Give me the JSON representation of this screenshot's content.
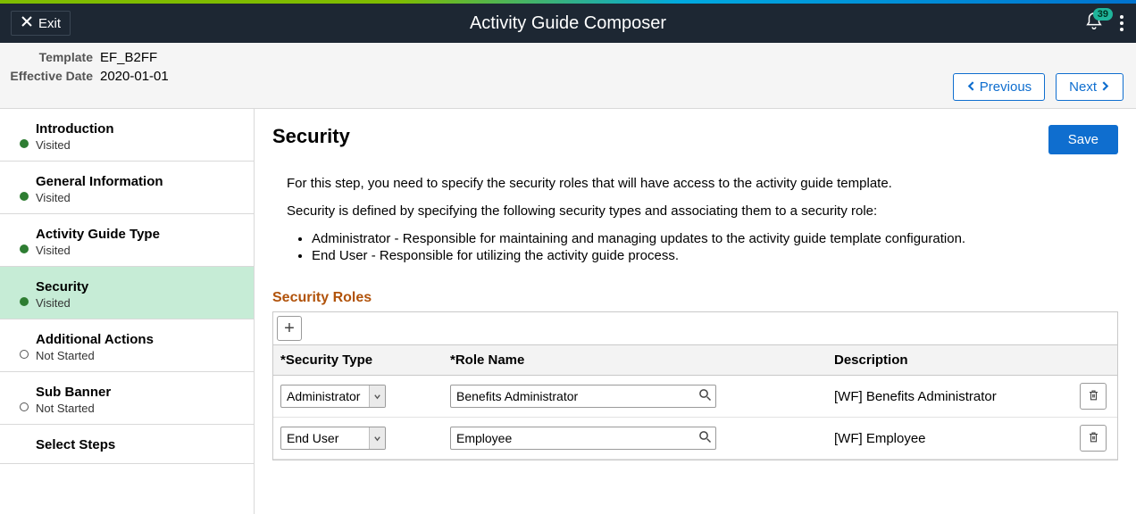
{
  "header": {
    "exit_label": "Exit",
    "title": "Activity Guide Composer",
    "notification_count": "39"
  },
  "meta": {
    "template_label": "Template",
    "template_value": "EF_B2FF",
    "effective_date_label": "Effective Date",
    "effective_date_value": "2020-01-01"
  },
  "nav": {
    "previous_label": "Previous",
    "next_label": "Next"
  },
  "sidebar": {
    "items": [
      {
        "title": "Introduction",
        "status": "Visited",
        "dot": "visited"
      },
      {
        "title": "General Information",
        "status": "Visited",
        "dot": "visited"
      },
      {
        "title": "Activity Guide Type",
        "status": "Visited",
        "dot": "visited"
      },
      {
        "title": "Security",
        "status": "Visited",
        "dot": "visited",
        "active": true
      },
      {
        "title": "Additional Actions",
        "status": "Not Started",
        "dot": "notstarted"
      },
      {
        "title": "Sub Banner",
        "status": "Not Started",
        "dot": "notstarted"
      },
      {
        "title": "Select Steps",
        "status": "",
        "dot": ""
      }
    ]
  },
  "main": {
    "title": "Security",
    "save_label": "Save",
    "intro_p1": "For this step, you need to specify the security roles that will have access to the activity guide template.",
    "intro_p2": "Security is defined by specifying the following security types and associating them to a security role:",
    "bullet1": "Administrator - Responsible for maintaining and managing updates to the activity guide template configuration.",
    "bullet2": "End User - Responsible for utilizing the activity guide process.",
    "section_title": "Security Roles",
    "col_type": "*Security Type",
    "col_role": "*Role Name",
    "col_desc": "Description",
    "rows": [
      {
        "type": "Administrator",
        "role": "Benefits Administrator",
        "desc": "[WF] Benefits Administrator"
      },
      {
        "type": "End User",
        "role": "Employee",
        "desc": "[WF] Employee"
      }
    ]
  }
}
